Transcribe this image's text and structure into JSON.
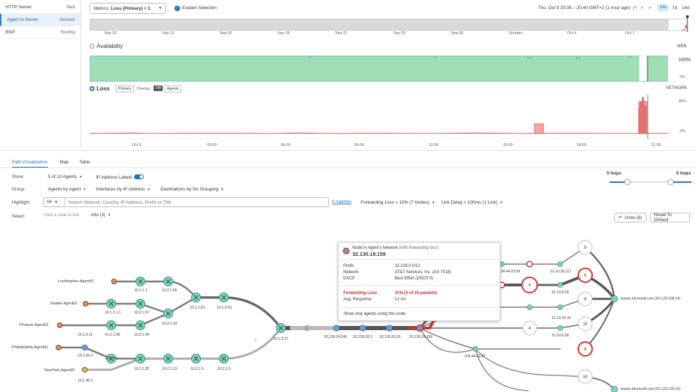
{
  "sidebar": {
    "items": [
      {
        "label": "HTTP Server",
        "sub": "Web"
      },
      {
        "label": "Agent to Server",
        "sub": "Network"
      },
      {
        "label": "BGP",
        "sub": "Routing"
      }
    ]
  },
  "topbar": {
    "metrics_label": "Metrics: ",
    "metrics_value": "Loss (Primary) + 1",
    "explain": "Explain Selection",
    "time_range": "Thu, Oct 9 20:35 – 20:40 GMT+2 (1 hour ago)",
    "nav_first": "|<",
    "nav_prev": "<",
    "nav_next": ">",
    "nav_last": ">|",
    "range_24h": "24h",
    "range_7d": "7d",
    "range_14d": "14d"
  },
  "timeline": {
    "ticks": [
      "Sep 10",
      "Sep 13",
      "Sep 16",
      "Sep 19",
      "Sep 22",
      "Sep 25",
      "Sep 28",
      "October",
      "Oct 4",
      "Oct 7"
    ]
  },
  "availability": {
    "title": "Availability",
    "badge": "WEB",
    "y_top": "100%",
    "y_bottom": "0%"
  },
  "loss": {
    "title": "Loss",
    "primary": "Primary",
    "overlay": "Overlay",
    "off": "Off",
    "agents": "Agents",
    "badge": "NETWORK",
    "y_top": "36%",
    "y_bottom": "0%",
    "ticks": [
      "Oct 9",
      "03:00",
      "06:00",
      "09:00",
      "12:00",
      "15:00",
      "18:00",
      "21:00"
    ]
  },
  "tabs": [
    "Path Visualization",
    "Map",
    "Table"
  ],
  "controls": {
    "show_label": "Show",
    "show_agents": "5 of 10 Agents",
    "ip_labels": "IP Address Labels",
    "group_label": "Group",
    "group_agents": "Agents by Agent",
    "group_interfaces": "Interfaces by IP Address",
    "group_destinations": "Destinations by No Grouping",
    "highlight_label": "Highlight",
    "highlight_scope": "All",
    "search_placeholder": "Search Network, Country, IP Address, Prefix or Title",
    "matches": "0 matches",
    "fwd_loss": "Forwarding Loss > 10%  (7 Nodes)",
    "link_delay": "Link Delay > 100ms  (1 Link)",
    "select_label": "Select",
    "select_hint": "Click a node or link",
    "info": "Info (3)",
    "hops_left": "5 hops",
    "hops_right": "5 hops",
    "undo": "Undo (8)",
    "reset": "Reset To Default"
  },
  "agents": [
    "LosAngeles-Agent01",
    "Seattle-Agent01",
    "Phoenix-Agent01",
    "Philadelphia-Agent01",
    "NewYork-Agent01"
  ],
  "nodes": [
    "10.1.1.1",
    "10.2.1.65",
    "10.1.2.1.1",
    "10.2.1.57",
    "10.2.1.49",
    "10.2.1.45",
    "10.2.1.53",
    "10.2.1.61",
    "10.1.3.41",
    "10.1.3.11",
    "10.1.50.1",
    "10.1.4.1",
    "10.2.1.25",
    "10.2.1.13",
    "10.2.1.9",
    "10.2.1.5",
    "10.1.40.1",
    "10.1.3.37",
    "32.130.24.240",
    "32.130.20.3",
    "32.130.20.19",
    "32.130.18.159",
    "104.44.23.67",
    "104.44.23.59",
    "51.10.39.117",
    "51.10.8.20",
    "51.10.15.16",
    "51.10.6.58"
  ],
  "counts": [
    "9",
    "8",
    "4",
    "8",
    "4",
    "10",
    "8",
    "10",
    "4",
    "1",
    "2"
  ],
  "destinations": [
    "teams.microsoft.com (52.123.128.14)",
    "teams.microsoft.com (52.123.129.14)"
  ],
  "tooltip": {
    "title": "Node in Agent's Network",
    "title_sub": "(with forwarding loss)",
    "ip": "32.130.18.159",
    "prefix_label": "Prefix",
    "prefix": "32.128.0.0/12",
    "network_label": "Network",
    "network": "AT&T Services, Inc. (AS 7018)",
    "dscp_label": "DSCP",
    "dscp": "Best Effort (DSCP 0)",
    "fwd_label": "Forwarding Loss",
    "fwd": "31% (5 of 16 packets)",
    "resp_label": "Avg. Response",
    "resp": "12 ms",
    "link": "Show only agents using this node"
  }
}
